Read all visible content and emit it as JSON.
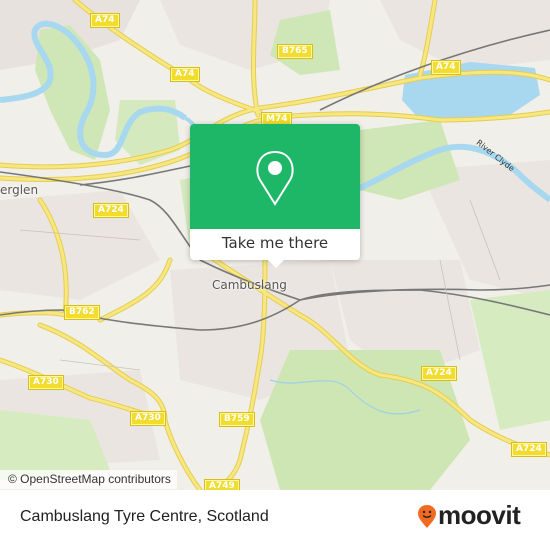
{
  "map": {
    "road_labels": [
      "A74",
      "A74",
      "A74",
      "B765",
      "M74",
      "A724",
      "B762",
      "A730",
      "A730",
      "B759",
      "A724",
      "A724",
      "A749"
    ],
    "place_labels": {
      "town": "Cambuslang",
      "partial_town": "erglen"
    },
    "river_label": "River Clyde",
    "attribution": "© OpenStreetMap contributors",
    "colors": {
      "land": "#f1efe9",
      "water": "#a8d8ef",
      "green": "#cde6b3",
      "road": "#f5e06a",
      "rail": "#777777"
    }
  },
  "popup": {
    "icon": "location-pin-icon",
    "button_label": "Take me there",
    "color": "#1db767"
  },
  "footer": {
    "title": "Cambuslang Tyre Centre, Scotland",
    "brand": "moovit",
    "brand_icon": "moovit-pin-smile-icon",
    "brand_color": "#f26b21"
  }
}
